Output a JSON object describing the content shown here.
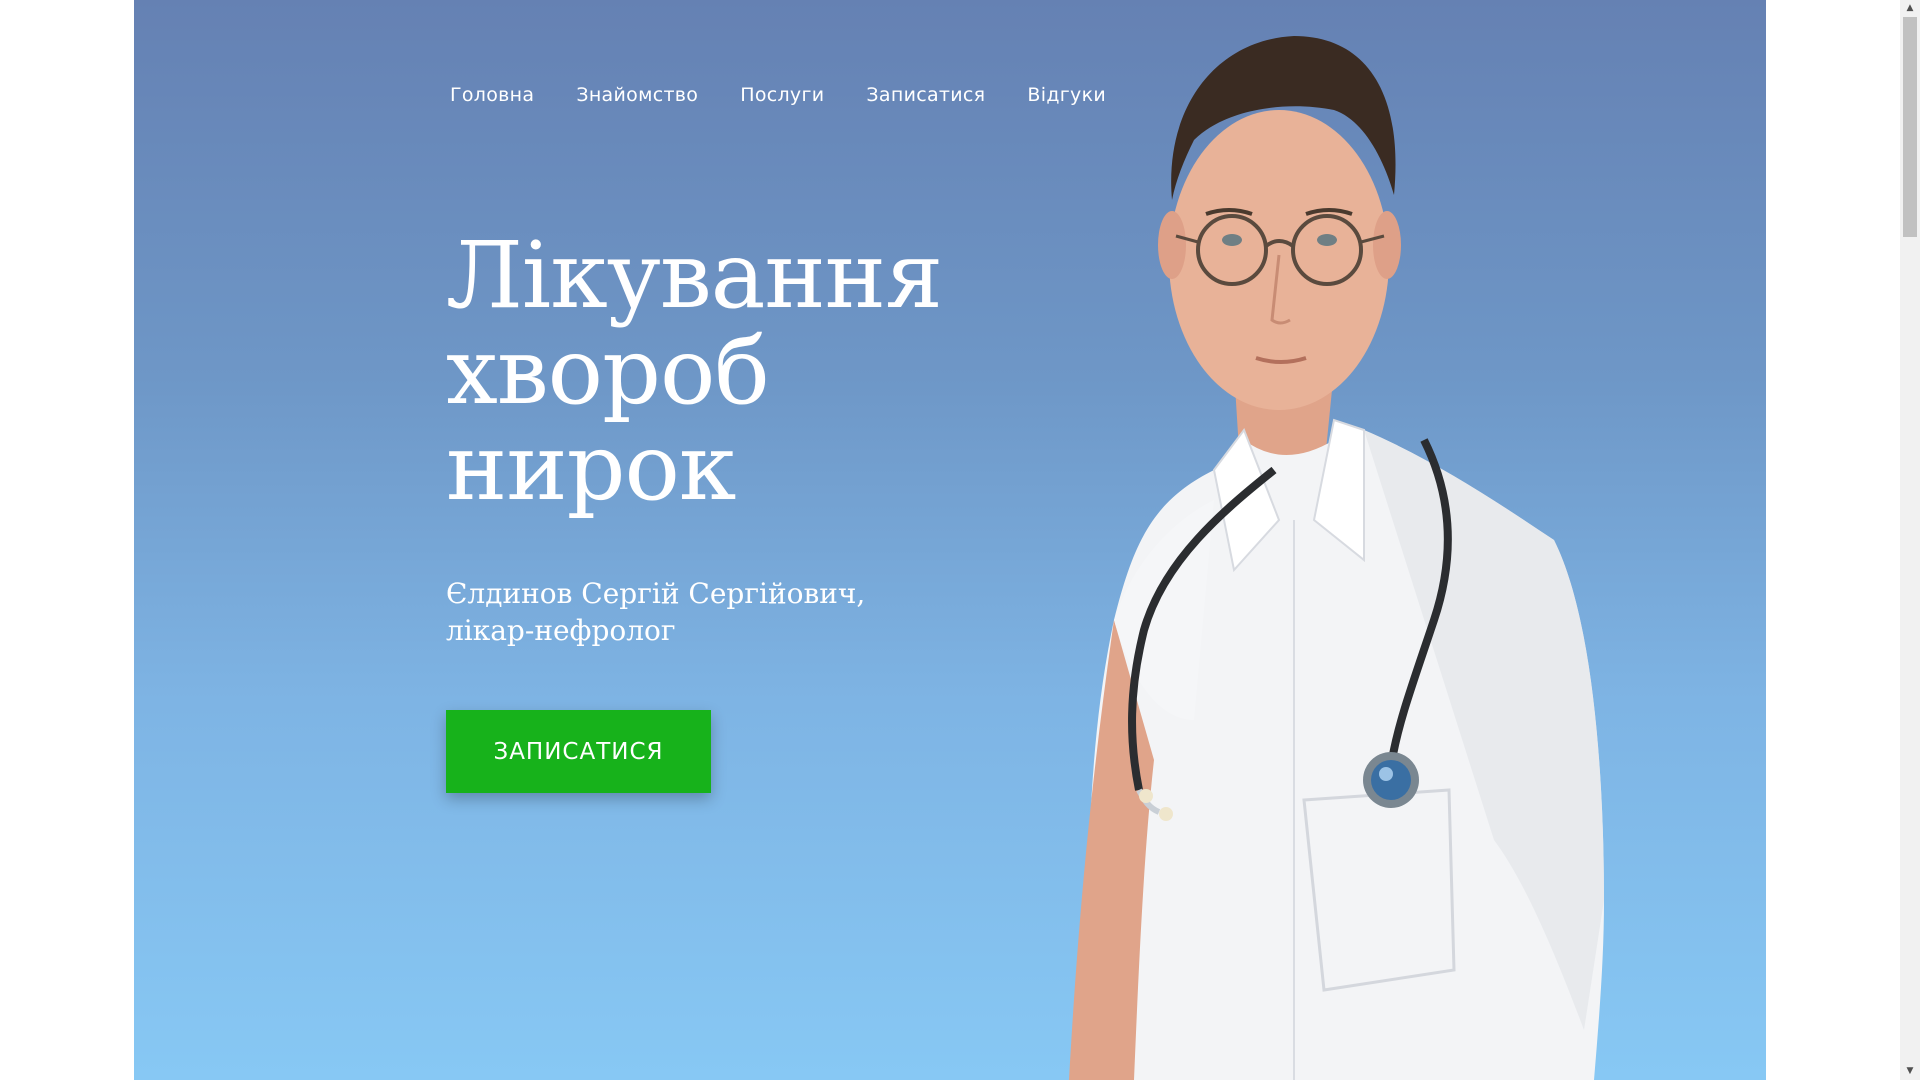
{
  "nav": {
    "items": [
      {
        "label": "Головна"
      },
      {
        "label": "Знайомство"
      },
      {
        "label": "Послуги"
      },
      {
        "label": "Записатися"
      },
      {
        "label": "Відгуки"
      }
    ]
  },
  "hero": {
    "title_lines": [
      "Лікування",
      "хвороб",
      "нирок"
    ],
    "name_line": "Єлдинов Сергій Сергійович,",
    "profession_line": "лікар-нефролог",
    "cta_label": "ЗАПИСАТИСЯ"
  },
  "colors": {
    "background_top": "#6581b3",
    "background_bottom": "#87c8f4",
    "cta": "#17b21b",
    "text": "#ffffff"
  },
  "icons": {
    "scroll_up": "scroll-up-arrow-icon",
    "scroll_down": "scroll-down-arrow-icon"
  }
}
